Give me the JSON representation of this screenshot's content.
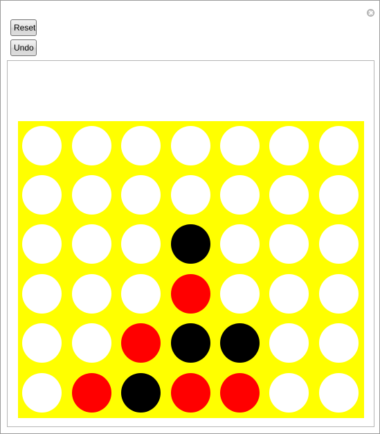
{
  "toolbar": {
    "reset_label": "Reset",
    "undo_label": "Undo"
  },
  "window": {
    "close_icon": "close-icon"
  },
  "colors": {
    "board": "#ffff00",
    "empty": "#ffffff",
    "red": "#ff0000",
    "black": "#000000"
  },
  "board": {
    "columns": 7,
    "rows": 6,
    "cells": [
      [
        "empty",
        "empty",
        "empty",
        "empty",
        "empty",
        "empty",
        "empty"
      ],
      [
        "empty",
        "empty",
        "empty",
        "empty",
        "empty",
        "empty",
        "empty"
      ],
      [
        "empty",
        "empty",
        "empty",
        "black",
        "empty",
        "empty",
        "empty"
      ],
      [
        "empty",
        "empty",
        "empty",
        "red",
        "empty",
        "empty",
        "empty"
      ],
      [
        "empty",
        "empty",
        "red",
        "black",
        "black",
        "empty",
        "empty"
      ],
      [
        "empty",
        "red",
        "black",
        "red",
        "red",
        "empty",
        "empty"
      ]
    ]
  }
}
